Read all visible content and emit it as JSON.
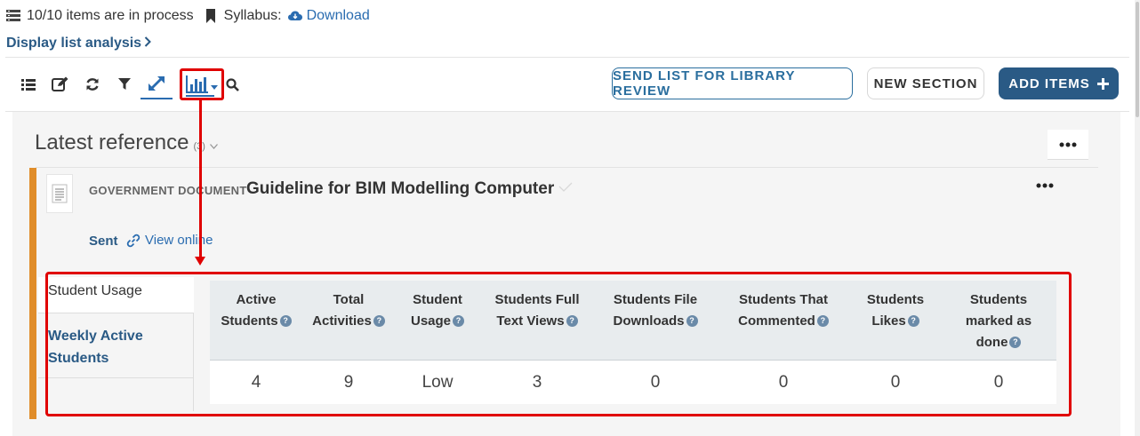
{
  "header": {
    "items_status": "10/10 items are in process",
    "syllabus_label": "Syllabus:",
    "syllabus_link": "Download",
    "display_analysis": "Display list analysis"
  },
  "toolbar": {
    "send_review": "SEND LIST FOR LIBRARY REVIEW",
    "new_section": "NEW SECTION",
    "add_items": "ADD ITEMS"
  },
  "section": {
    "title": "Latest reference",
    "count": "(3)"
  },
  "item": {
    "type": "GOVERNMENT DOCUMENT",
    "title": "Guideline for BIM Modelling Computer",
    "status": "Sent",
    "view_online": "View online"
  },
  "analytics": {
    "tabs": [
      "Student Usage",
      "Weekly Active Students"
    ],
    "columns": [
      {
        "line1": "Active",
        "line2": "Students",
        "line3": ""
      },
      {
        "line1": "Total",
        "line2": "Activities",
        "line3": ""
      },
      {
        "line1": "Student",
        "line2": "Usage",
        "line3": ""
      },
      {
        "line1": "Students Full",
        "line2": "Text Views",
        "line3": ""
      },
      {
        "line1": "Students File",
        "line2": "Downloads",
        "line3": ""
      },
      {
        "line1": "Students That",
        "line2": "Commented",
        "line3": ""
      },
      {
        "line1": "Students",
        "line2": "Likes",
        "line3": ""
      },
      {
        "line1": "Students",
        "line2": "marked as",
        "line3": "done"
      }
    ],
    "values": [
      "4",
      "9",
      "Low",
      "3",
      "0",
      "0",
      "0",
      "0"
    ]
  }
}
